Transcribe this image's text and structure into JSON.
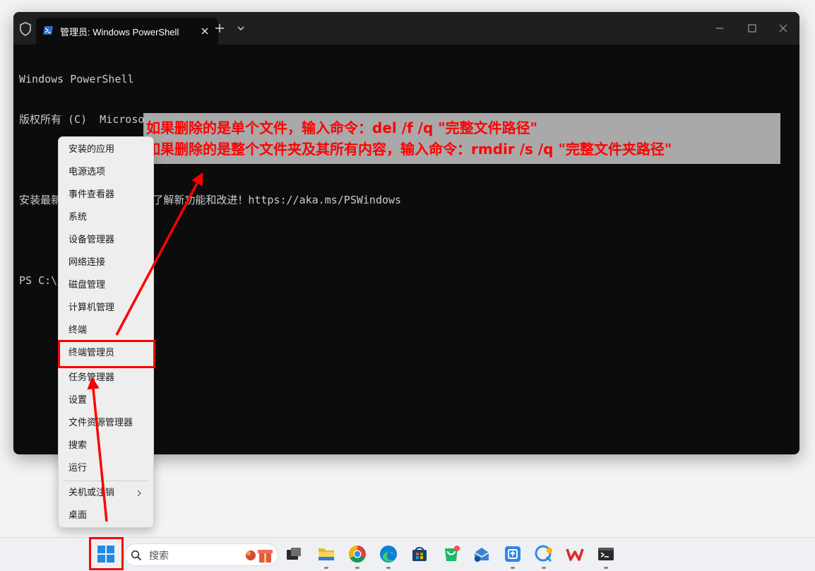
{
  "window": {
    "tab_title": "管理员: Windows PowerShell"
  },
  "terminal": {
    "lines": [
      "Windows PowerShell",
      "版权所有 (C)  Microsoft Corporation。保留所有权利。",
      "",
      "安装最新的 PowerShell，了解新功能和改进！https://aka.ms/PSWindows"
    ],
    "prompt_prefix": "PS C:\\Users\\",
    "prompt_suffix": ">"
  },
  "annotation": {
    "line1": "如果删除的是单个文件，输入命令：del /f /q \"完整文件路径\"",
    "line2": "如果删除的是整个文件夹及其所有内容，输入命令：rmdir /s /q \"完整文件夹路径\""
  },
  "context_menu": {
    "items": [
      "安装的应用",
      "电源选项",
      "事件查看器",
      "系统",
      "设备管理器",
      "网络连接",
      "磁盘管理",
      "计算机管理",
      "终端",
      "终端管理员",
      "任务管理器",
      "设置",
      "文件资源管理器",
      "搜索",
      "运行",
      "关机或注销",
      "桌面"
    ],
    "highlighted": "终端管理员"
  },
  "taskbar": {
    "search_placeholder": "搜索",
    "apps": [
      "task-view-icon",
      "file-explorer-icon",
      "chrome-icon",
      "edge-icon",
      "microsoft-store-icon",
      "green-app-icon",
      "mail-app-icon",
      "tencent-app-icon",
      "chat-app-icon",
      "wps-icon",
      "terminal-icon"
    ]
  },
  "colors": {
    "terminal_bg": "#0c0c0c",
    "titlebar_bg": "#1f1f1f",
    "annotation_text": "#ff0000",
    "annotation_bg": "#a9a9a9",
    "highlight_border": "#ff0000"
  }
}
